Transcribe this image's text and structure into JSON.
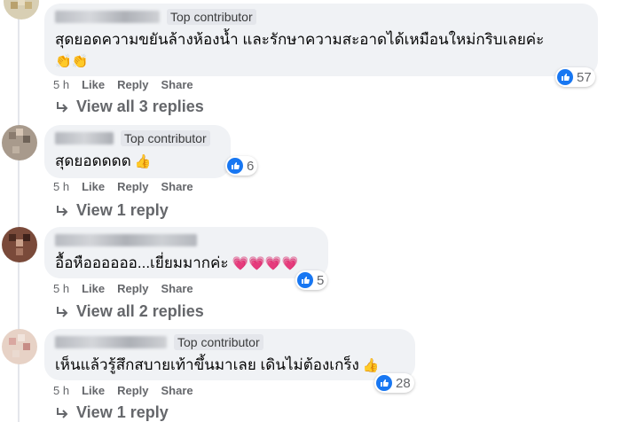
{
  "comments": [
    {
      "badge": "Top contributor",
      "text": "สุดยอดความขยันล้างห้องน้ำ และรักษาความสะอาดได้เหมือนใหม่กริบเลยค่ะ",
      "emoji": "👏👏",
      "reactions": "57",
      "time": "5 h",
      "like": "Like",
      "reply": "Share",
      "replies": "View all 3 replies"
    },
    {
      "badge": "Top contributor",
      "text": "สุดยอดดดด",
      "emoji": "👍",
      "reactions": "6",
      "time": "5 h",
      "like": "Like",
      "reply": "Reply",
      "share": "Share",
      "replies": "View 1 reply"
    },
    {
      "badge": "",
      "text": "อื้อหืออออออ...เยี่ยมมากค่ะ",
      "emoji": "💗💗💗💗",
      "reactions": "5",
      "time": "5 h",
      "like": "Like",
      "reply": "Reply",
      "share": "Share",
      "replies": "View all 2 replies"
    },
    {
      "badge": "Top contributor",
      "text": "เห็นแล้วรู้สึกสบายเท้าขึ้นมาเลย เดินไม่ต้องเกร็ง",
      "emoji": "👍",
      "reactions": "28",
      "time": "5 h",
      "like": "Like",
      "reply": "Reply",
      "share": "Share",
      "replies": "View 1 reply"
    }
  ],
  "first_actions": {
    "like": "Like",
    "reply": "Reply",
    "share": "Share"
  },
  "colors": {
    "bubble": "#f0f2f5",
    "like_blue": "#1877f2",
    "meta_gray": "#65676b"
  },
  "icons": {
    "reply_arrow": "reply-arrow-icon",
    "like": "like-thumb-icon"
  }
}
